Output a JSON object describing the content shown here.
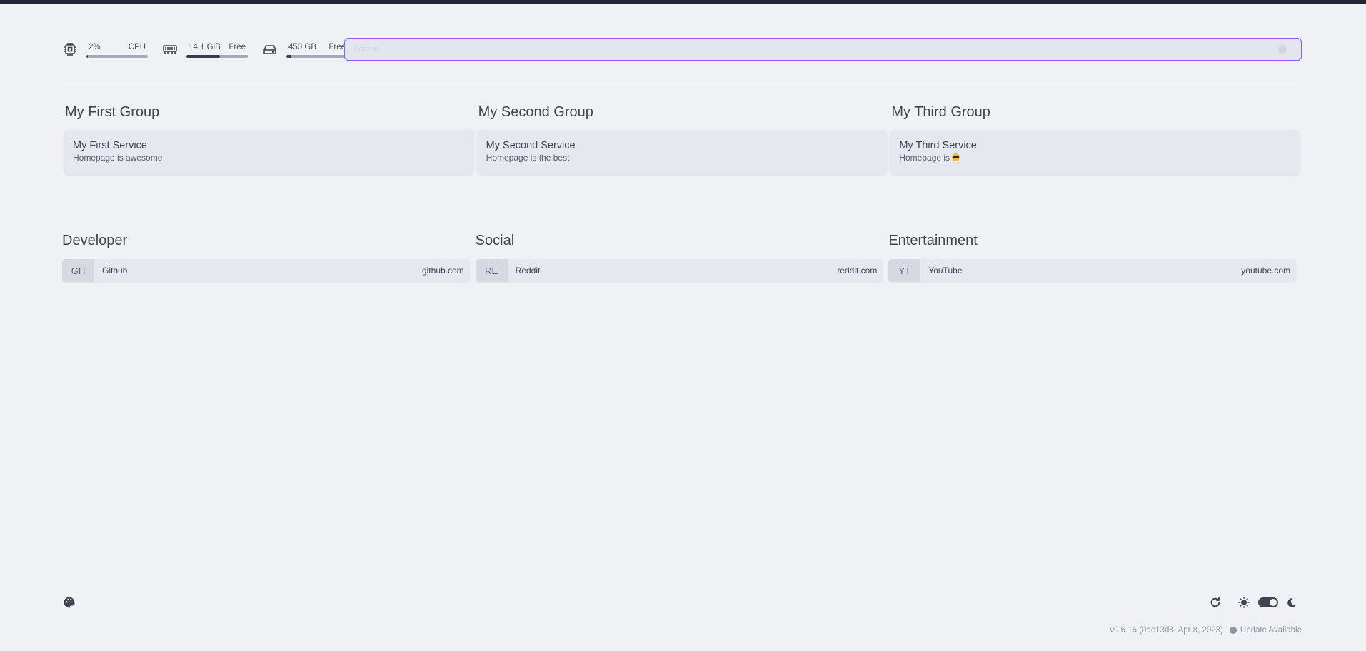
{
  "widgets": {
    "cpu": {
      "value": "2%",
      "label": "CPU",
      "usage": 0.02
    },
    "memory": {
      "value": "14.1 GiB",
      "label": "Free",
      "usage": 0.55
    },
    "disk": {
      "value": "450 GB",
      "label": "Free",
      "usage": 0.08
    }
  },
  "search": {
    "placeholder": "Search"
  },
  "service_groups": [
    {
      "title": "My First Group",
      "service": {
        "name": "My First Service",
        "description": "Homepage is awesome"
      }
    },
    {
      "title": "My Second Group",
      "service": {
        "name": "My Second Service",
        "description": "Homepage is the best"
      }
    },
    {
      "title": "My Third Group",
      "service": {
        "name": "My Third Service",
        "description": "Homepage is"
      }
    }
  ],
  "bookmark_groups": [
    {
      "title": "Developer",
      "item": {
        "abbr": "GH",
        "name": "Github",
        "url": "github.com"
      }
    },
    {
      "title": "Social",
      "item": {
        "abbr": "RE",
        "name": "Reddit",
        "url": "reddit.com"
      }
    },
    {
      "title": "Entertainment",
      "item": {
        "abbr": "YT",
        "name": "YouTube",
        "url": "youtube.com"
      }
    }
  ],
  "footer": {
    "version": "v0.6.16 (0ae13d8, Apr 8, 2023)",
    "update": "Update Available",
    "theme": "dark"
  },
  "colors": {
    "accent": "#8b5cf6",
    "background": "#eff1f5",
    "card": "#e5e8ef",
    "text": "#3f4451"
  }
}
